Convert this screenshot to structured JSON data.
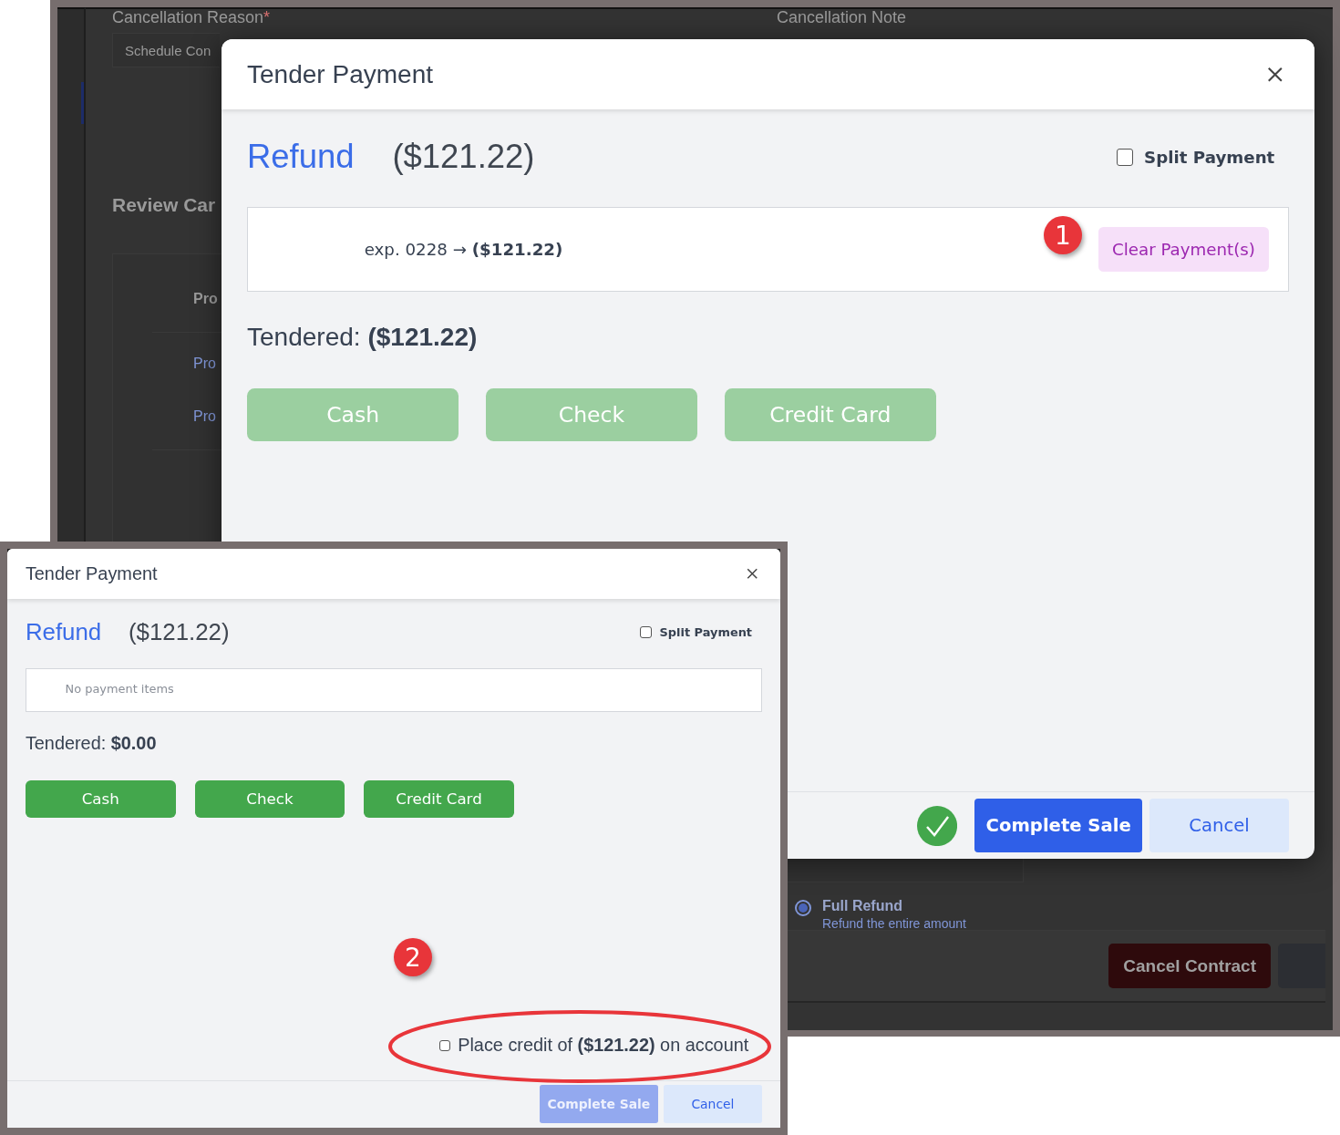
{
  "background_page": {
    "cancellation_reason": {
      "label": "Cancellation Reason",
      "required_mark": "*",
      "value": "Schedule Con"
    },
    "cancellation_note": {
      "label": "Cancellation Note"
    },
    "section_title": "Review Car",
    "table": {
      "header": "Pro",
      "rows": [
        "Pro",
        "Pro"
      ]
    },
    "refund_options": [
      {
        "label": "Full Refund",
        "description": "Refund the entire amount",
        "selected": true
      }
    ],
    "cancel_contract_button": "Cancel Contract"
  },
  "dialogs": [
    {
      "title": "Tender Payment",
      "mode": "Refund",
      "amount": "($121.22)",
      "split_payment": {
        "label": "Split Payment",
        "checked": false
      },
      "payment_items": [
        {
          "text": "exp. 0228 → **($121.22)**"
        }
      ],
      "clear_button": "Clear Payment(s)",
      "tendered": {
        "label": "Tendered:",
        "amount": "($121.22)"
      },
      "methods": [
        {
          "label": "Cash",
          "disabled": true
        },
        {
          "label": "Check",
          "disabled": true
        },
        {
          "label": "Credit Card",
          "disabled": true
        }
      ],
      "ready": true,
      "complete_button": {
        "label": "Complete Sale",
        "disabled": false
      },
      "cancel_button": "Cancel"
    },
    {
      "title": "Tender Payment",
      "mode": "Refund",
      "amount": "($121.22)",
      "split_payment": {
        "label": "Split Payment",
        "checked": false
      },
      "empty_message": "No payment items",
      "tendered": {
        "label": "Tendered:",
        "amount": "$0.00"
      },
      "methods": [
        {
          "label": "Cash",
          "disabled": false
        },
        {
          "label": "Check",
          "disabled": false
        },
        {
          "label": "Credit Card",
          "disabled": false
        }
      ],
      "ready": false,
      "place_credit": {
        "text": "Place credit of **($121.22)** on account",
        "checked": false
      },
      "complete_button": {
        "label": "Complete Sale",
        "disabled": true
      },
      "cancel_button": "Cancel"
    }
  ],
  "annotations": [
    {
      "kind": "marker",
      "label": "1"
    },
    {
      "kind": "marker",
      "label": "2"
    },
    {
      "kind": "ellipse"
    }
  ]
}
